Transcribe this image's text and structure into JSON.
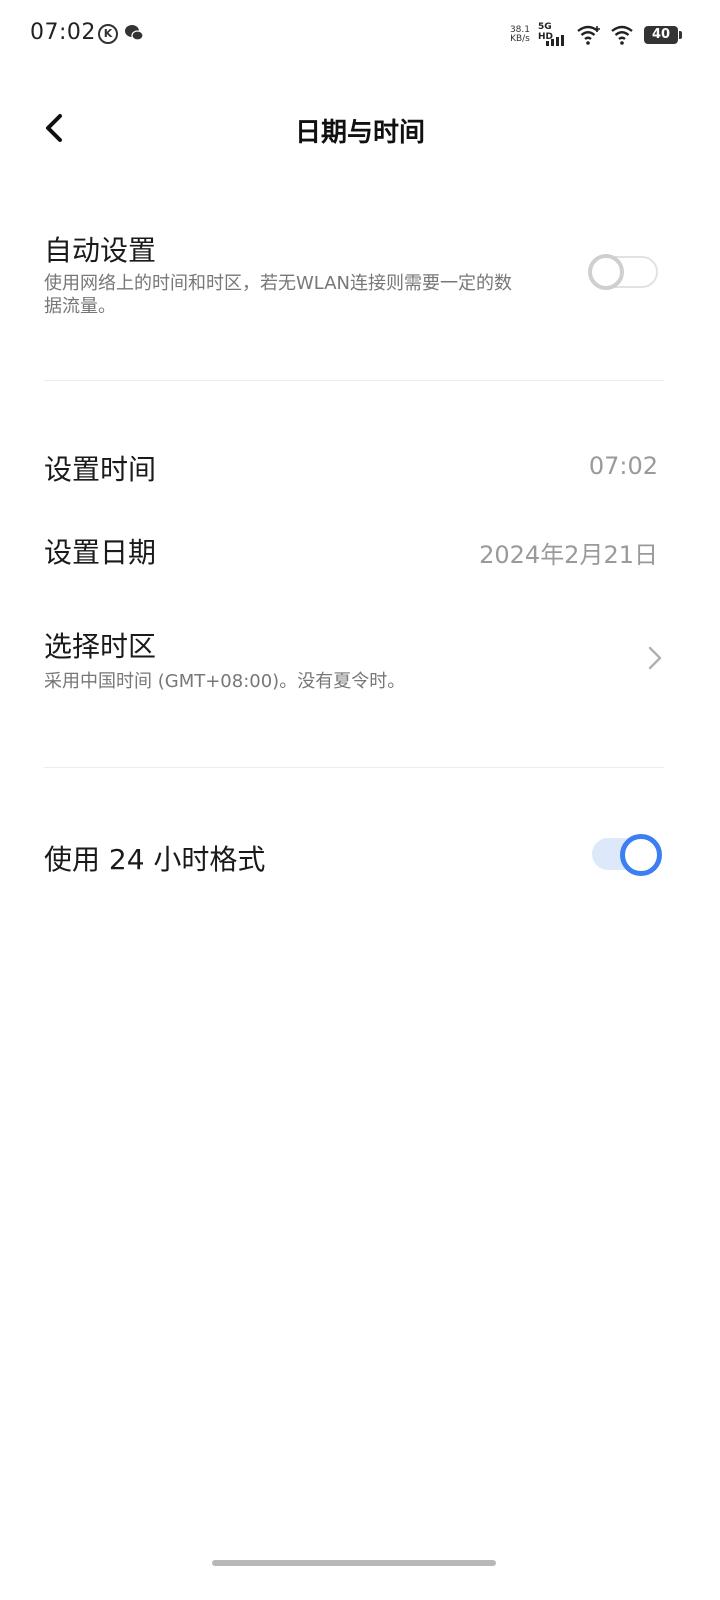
{
  "status_bar": {
    "time": "07:02",
    "net_speed_value": "38.1",
    "net_speed_unit": "KB/s",
    "network_label": "5G HD",
    "battery": "40"
  },
  "header": {
    "title": "日期与时间"
  },
  "auto_setting": {
    "title": "自动设置",
    "description": "使用网络上的时间和时区，若无WLAN连接则需要一定的数据流量。",
    "enabled": false
  },
  "set_time": {
    "title": "设置时间",
    "value": "07:02"
  },
  "set_date": {
    "title": "设置日期",
    "value": "2024年2月21日"
  },
  "time_zone": {
    "title": "选择时区",
    "description": "采用中国时间 (GMT+08:00)。没有夏令时。"
  },
  "format_24h": {
    "title": "使用 24 小时格式",
    "enabled": true
  },
  "colors": {
    "accent": "#3d7ff0",
    "toggle_on_track": "#dde9fb",
    "secondary_text": "#777777"
  }
}
